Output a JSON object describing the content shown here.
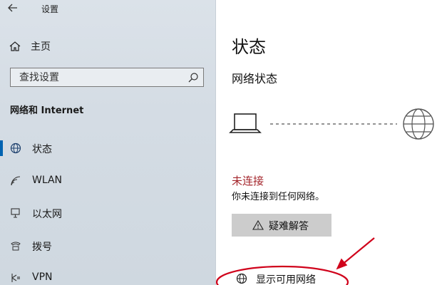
{
  "window": {
    "title": "设置"
  },
  "sidebar": {
    "home_label": "主页",
    "search": {
      "placeholder": "查找设置"
    },
    "section_title": "网络和 Internet",
    "items": [
      {
        "label": "状态",
        "icon": "globe-icon",
        "selected": true
      },
      {
        "label": "WLAN",
        "icon": "wifi-icon",
        "selected": false
      },
      {
        "label": "以太网",
        "icon": "ethernet-icon",
        "selected": false
      },
      {
        "label": "拨号",
        "icon": "dialup-icon",
        "selected": false
      },
      {
        "label": "VPN",
        "icon": "vpn-icon",
        "selected": false
      }
    ]
  },
  "main": {
    "title": "状态",
    "section": "网络状态",
    "status_title": "未连接",
    "status_desc": "你未连接到任何网络。",
    "troubleshoot_label": "疑难解答",
    "show_networks_label": "显示可用网络"
  },
  "colors": {
    "accent": "#0063b1",
    "error": "#a4262c",
    "annotation": "#d0021b",
    "button_bg": "#cccccc"
  }
}
